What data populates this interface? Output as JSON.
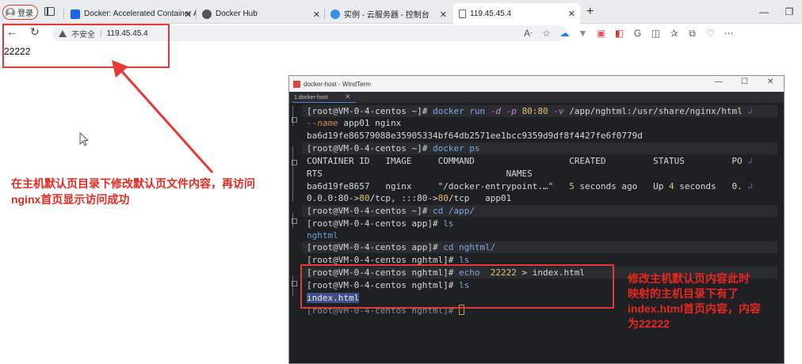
{
  "browser": {
    "profile_label": "登录",
    "tabs": [
      {
        "title": "Docker: Accelerated Container A",
        "active": false
      },
      {
        "title": "Docker Hub",
        "active": false
      },
      {
        "title": "实例 - 云服务器 - 控制台",
        "active": false
      },
      {
        "title": "119.45.45.4",
        "active": true
      }
    ],
    "insecure_label": "不安全",
    "separator": "|",
    "url": "119.45.45.4"
  },
  "page": {
    "body_text": "22222"
  },
  "annotations": {
    "left_note_line1": "在主机默认页目录下修改默认页文件内容，再访问",
    "left_note_line2": "nginx首页显示访问成功",
    "right_note_line1": "修改主机默认页内容此时",
    "right_note_line2": "映射的主机目录下有了",
    "right_note_line3": "index.html首页内容，内容",
    "right_note_line4": "为22222",
    "color": "#e8281e"
  },
  "terminal": {
    "window_title": "docker-host - WindTerm",
    "tab_label": "1.docker-host",
    "lines": {
      "l1_prompt": "[root@VM-0-4-centos ~]# ",
      "l1_cmd": "docker run ",
      "l1_f1": "-d",
      "l1_f2": "-p",
      "l1_port": "80:80",
      "l1_f3": "-v",
      "l1_vol": "/app/nghtml:/usr/share/nginx/html",
      "l2_flag": "--name",
      "l2_rest": " app01 nginx",
      "l3_id": "ba6d19fe86579088e35905334bf64db2571ee1bcc9359d9df8f4427fe6f0779d",
      "l4_prompt": "[root@VM-0-4-centos ~]# ",
      "l4_cmd": "docker ps",
      "l5_headers": "CONTAINER ID   IMAGE     COMMAND                  CREATED         STATUS         PO",
      "l6_headers": "RTS                                   NAMES",
      "l7_a": "ba6d19fe8657   nginx     \"/docker-entrypoint.…\"   ",
      "l7_b": "5",
      "l7_c": " seconds ago   Up ",
      "l7_d": "4",
      "l7_e": " seconds   0.",
      "l8_a": "0.0.0:80->",
      "l8_b": "80",
      "l8_c": "/tcp, :::80->",
      "l8_d": "80",
      "l8_e": "/tcp   app01",
      "l9_prompt": "[root@VM-0-4-centos ~]# ",
      "l9_cmd": "cd /app/",
      "l10_prompt": "[root@VM-0-4-centos app]# ",
      "l10_cmd": "ls",
      "l11_dir": "nghtml",
      "l12_prompt": "[root@VM-0-4-centos app]# ",
      "l12_cmd": "cd nghtml/",
      "l13_prompt": "[root@VM-0-4-centos nghtml]# ",
      "l13_cmd": "ls",
      "l14_prompt": "[root@VM-0-4-centos nghtml]# ",
      "l14_cmd": "echo ",
      "l14_num": " 22222",
      "l14_rest": " > index.html",
      "l15_prompt": "[root@VM-0-4-centos nghtml]# ",
      "l15_cmd": "ls",
      "l16_file": "index.html",
      "l17_prompt": "[root@VM-0-4-centos nghtml]# "
    }
  }
}
